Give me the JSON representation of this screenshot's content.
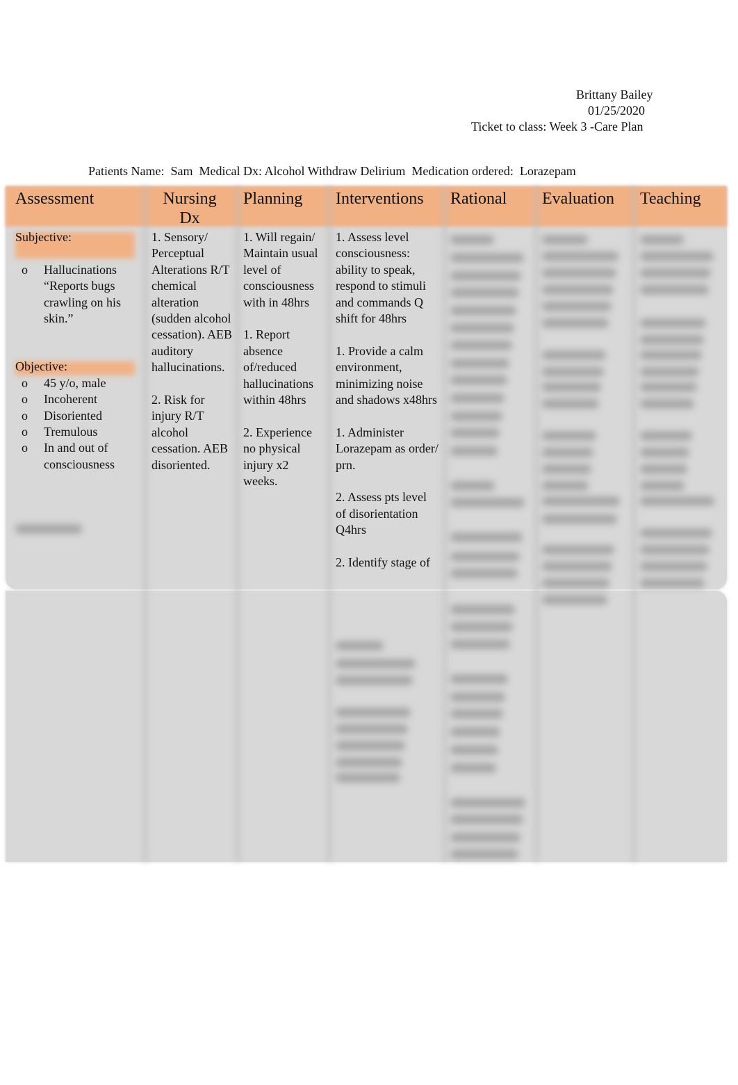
{
  "header": {
    "name": "Brittany Bailey",
    "date": "01/25/2020",
    "assignment": "Ticket to class: Week 3 -Care Plan"
  },
  "patient_line": {
    "name_label": "Patients Name:",
    "name": "Sam",
    "dx_label": "Medical Dx:",
    "dx": "Alcohol Withdraw Delirium",
    "med_label": "Medication ordered:",
    "med": "Lorazepam"
  },
  "table": {
    "headers": [
      "Assessment",
      "Nursing Dx",
      "Planning",
      "Interventions",
      "Rational",
      "Evaluation",
      "Teaching"
    ],
    "assessment": {
      "subjective_label": "Subjective:",
      "subjective": [
        "Hallucinations “Reports bugs crawling on his skin.”"
      ],
      "objective_label": "Objective:",
      "objective": [
        "45 y/o, male",
        "Incoherent",
        "Disoriented",
        "Tremulous",
        "In and out of consciousness"
      ]
    },
    "nursing_dx": [
      "1. Sensory/ Perceptual Alterations R/T chemical alteration (sudden alcohol cessation). AEB auditory hallucinations.",
      "2. Risk for injury R/T alcohol cessation. AEB disoriented."
    ],
    "planning": [
      "1. Will regain/ Maintain usual level of consciousness with in 48hrs",
      "1. Report absence of/reduced hallucinations within 48hrs",
      "2. Experience no physical injury x2 weeks."
    ],
    "interventions": [
      "1. Assess level consciousness: ability to speak, respond to stimuli and commands Q shift for 48hrs",
      "1. Provide a calm environment, minimizing noise and shadows x48hrs",
      "1. Administer Lorazepam as order/ prn.",
      "2.  Assess pts level of disorientation Q4hrs",
      "2. Identify stage of"
    ]
  },
  "colors": {
    "header_band": "#f2b183",
    "cell_bg": "#d8d8d8"
  }
}
